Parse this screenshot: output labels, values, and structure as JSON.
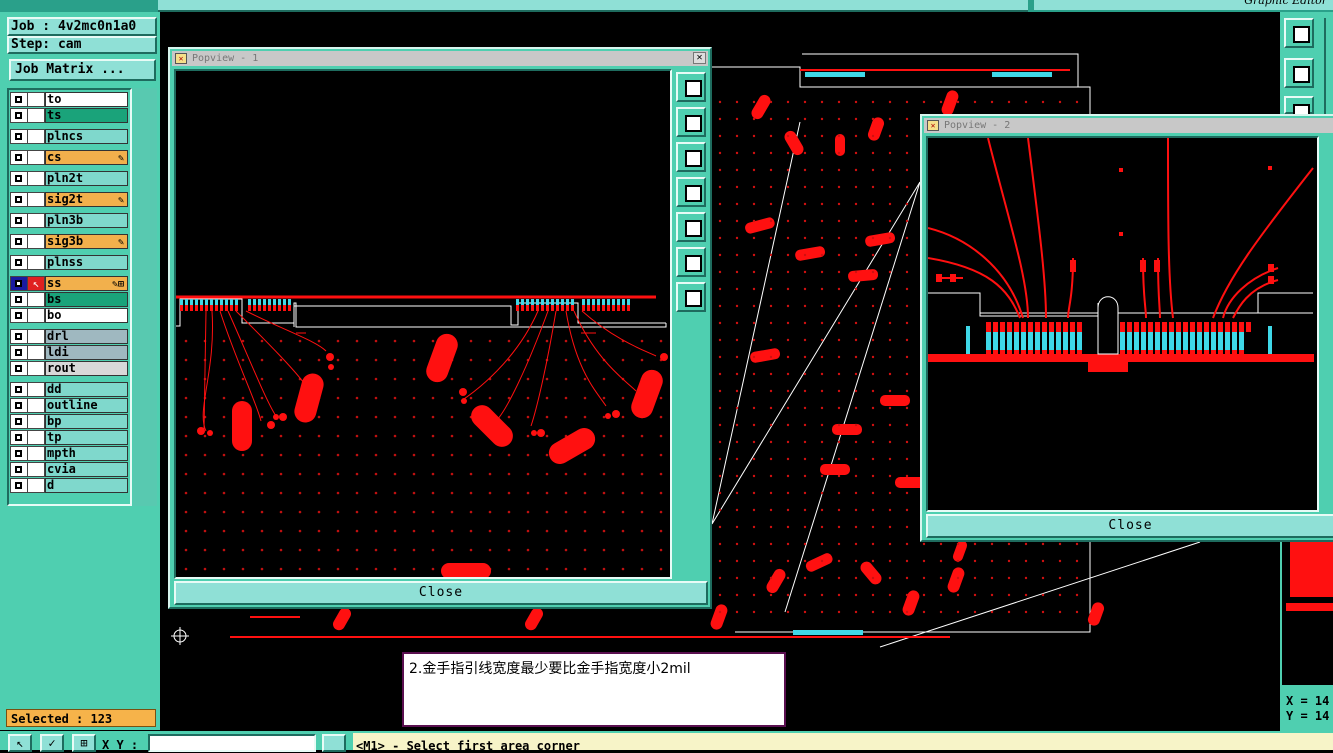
{
  "app": {
    "title_right": "Graphic Editor"
  },
  "job": {
    "label": "Job : 4v2mc0n1a0",
    "step": "Step: cam",
    "matrix_button": "Job Matrix ..."
  },
  "layers": [
    {
      "name": "to",
      "color": "#ffffff"
    },
    {
      "name": "ts",
      "color": "#1aa37a"
    },
    {
      "name": "plncs",
      "color": "#7fd8cc"
    },
    {
      "name": "cs",
      "color": "#f2b04c",
      "flag": "✎"
    },
    {
      "name": "pln2t",
      "color": "#7fd8cc"
    },
    {
      "name": "sig2t",
      "color": "#f2b04c",
      "flag": "✎"
    },
    {
      "name": "pln3b",
      "color": "#7fd8cc"
    },
    {
      "name": "sig3b",
      "color": "#f2b04c",
      "flag": "✎"
    },
    {
      "name": "plnss",
      "color": "#7fd8cc"
    },
    {
      "name": "ss",
      "color": "#f2b04c",
      "flag": "✎⊞",
      "active": true
    },
    {
      "name": "bs",
      "color": "#1aa37a"
    },
    {
      "name": "bo",
      "color": "#ffffff"
    },
    {
      "name": "drl",
      "color": "#9fb8c0"
    },
    {
      "name": "ldi",
      "color": "#9fb8c0"
    },
    {
      "name": "rout",
      "color": "#d8d8d8"
    },
    {
      "name": "dd",
      "color": "#7fd8cc"
    },
    {
      "name": "outline",
      "color": "#7fd8cc"
    },
    {
      "name": "bp",
      "color": "#7fd8cc"
    },
    {
      "name": "tp",
      "color": "#7fd8cc"
    },
    {
      "name": "mpth",
      "color": "#7fd8cc"
    },
    {
      "name": "cvia",
      "color": "#7fd8cc"
    },
    {
      "name": "d",
      "color": "#7fd8cc"
    }
  ],
  "status": {
    "selected": "Selected : 123",
    "prompt": "<M1> - Select first area corner",
    "xy_label": "X Y :"
  },
  "coords": {
    "x": "X = 14",
    "y": "Y = 14"
  },
  "popview1": {
    "title": "Popview - 1",
    "close": "Close"
  },
  "popview2": {
    "title": "Popview - 2",
    "close": "Close"
  },
  "annotation": {
    "text": "2.金手指引线宽度最少要比金手指宽度小2mil"
  },
  "colors": {
    "teal": "#4fcfb0",
    "trace_red": "#ff1010",
    "pad_cyan": "#3fd8e8"
  }
}
